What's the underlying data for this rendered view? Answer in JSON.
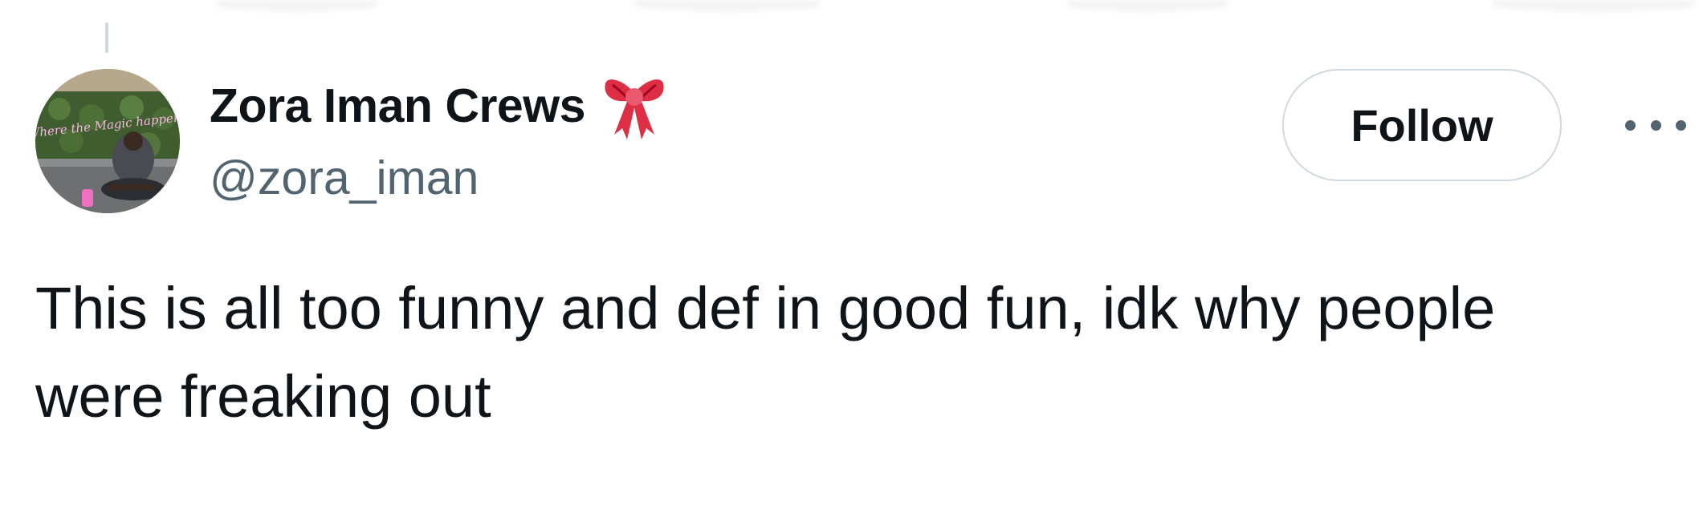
{
  "tweet": {
    "author": {
      "display_name": "Zora Iman Crews",
      "name_emoji_icon": "ribbon-bow-icon",
      "handle": "@zora_iman",
      "avatar_sign_text": "Where the Magic happens"
    },
    "follow_label": "Follow",
    "more_icon": "more-dots-icon",
    "text_lines": [
      "This is all too funny and def in good fun, idk why people",
      "were freaking out"
    ]
  },
  "colors": {
    "text_primary": "#0f1419",
    "text_secondary": "#536471",
    "border": "#cfd9de",
    "bow_red": "#dd2e44",
    "neon_pink": "#f472c8"
  }
}
